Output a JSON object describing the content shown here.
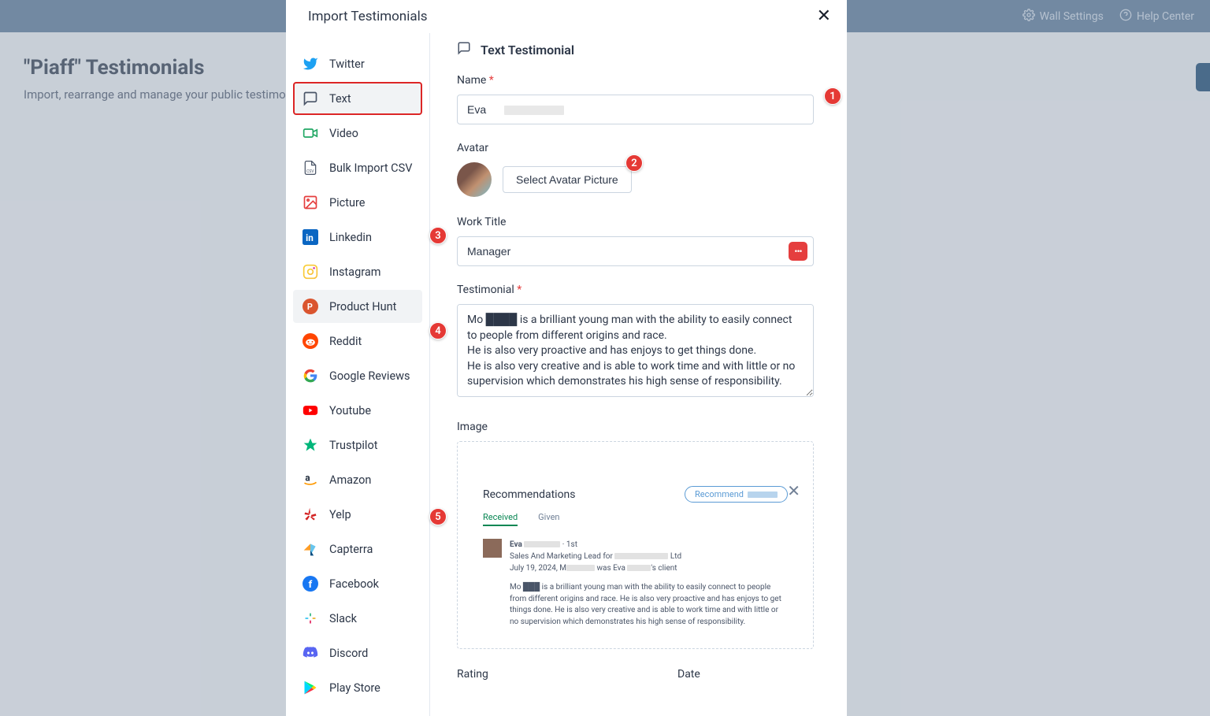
{
  "topbar": {
    "wall_settings": "Wall Settings",
    "help_center": "Help Center"
  },
  "page": {
    "title": "\"Piaff\" Testimonials",
    "subtitle": "Import, rearrange and manage your public testimon"
  },
  "modal": {
    "title": "Import Testimonials"
  },
  "sidebar": {
    "items": [
      {
        "label": "Twitter",
        "icon": "twitter"
      },
      {
        "label": "Text",
        "icon": "text",
        "selected": true
      },
      {
        "label": "Video",
        "icon": "video"
      },
      {
        "label": "Bulk Import CSV",
        "icon": "csv"
      },
      {
        "label": "Picture",
        "icon": "picture"
      },
      {
        "label": "Linkedin",
        "icon": "linkedin"
      },
      {
        "label": "Instagram",
        "icon": "instagram"
      },
      {
        "label": "Product Hunt",
        "icon": "producthunt",
        "bg": true
      },
      {
        "label": "Reddit",
        "icon": "reddit"
      },
      {
        "label": "Google Reviews",
        "icon": "google"
      },
      {
        "label": "Youtube",
        "icon": "youtube"
      },
      {
        "label": "Trustpilot",
        "icon": "trustpilot"
      },
      {
        "label": "Amazon",
        "icon": "amazon"
      },
      {
        "label": "Yelp",
        "icon": "yelp"
      },
      {
        "label": "Capterra",
        "icon": "capterra"
      },
      {
        "label": "Facebook",
        "icon": "facebook"
      },
      {
        "label": "Slack",
        "icon": "slack"
      },
      {
        "label": "Discord",
        "icon": "discord"
      },
      {
        "label": "Play Store",
        "icon": "playstore"
      }
    ]
  },
  "form": {
    "heading": "Text Testimonial",
    "name_label": "Name",
    "name_value": "Eva ",
    "avatar_label": "Avatar",
    "avatar_btn": "Select Avatar Picture",
    "work_title_label": "Work Title",
    "work_title_value": "Manager",
    "testimonial_label": "Testimonial",
    "testimonial_value": "Mo ████ is a brilliant young man with the ability to easily connect to people from different origins and race.\nHe is also very proactive and has enjoys to get things done.\nHe is also very creative and is able to work time and with little or no supervision which demonstrates his high sense of responsibility.",
    "image_label": "Image",
    "rating_label": "Rating",
    "date_label": "Date"
  },
  "preview": {
    "title": "Recommendations",
    "btn": "Recommend",
    "tab_received": "Received",
    "tab_given": "Given",
    "name": "Eva",
    "deg": "1st",
    "role_pre": "Sales And Marketing Lead for",
    "role_suf": "Ltd",
    "date": "July 19, 2024,",
    "date_mid": "M",
    "date_mid2": "was Eva",
    "date_suf": "'s client",
    "body": "Mo ███ is a brilliant young man with the ability to easily connect to people from different origins and race. He is also very proactive and has enjoys to get things done. He is also very creative and is able to work time and with little or no supervision which demonstrates his high sense of responsibility."
  },
  "badges": [
    "1",
    "2",
    "3",
    "4",
    "5"
  ]
}
